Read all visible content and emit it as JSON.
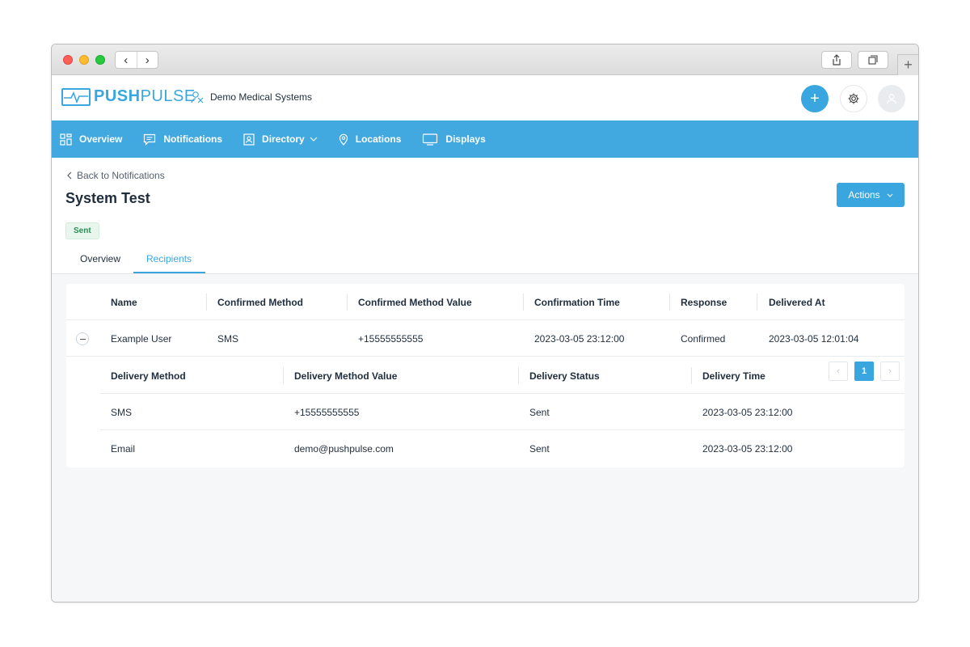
{
  "colors": {
    "accent": "#3aa6df",
    "nav_bg": "#42a8e0",
    "badge_text": "#2e8b57"
  },
  "browser": {
    "back_glyph": "‹",
    "forward_glyph": "›",
    "new_tab_glyph": "+"
  },
  "header": {
    "logo_bold": "PUSH",
    "logo_light": "PULSE",
    "org_name": "Demo Medical Systems",
    "plus_glyph": "+"
  },
  "nav": {
    "items": [
      {
        "label": "Overview",
        "icon": "grid-icon"
      },
      {
        "label": "Notifications",
        "icon": "message-icon"
      },
      {
        "label": "Directory",
        "icon": "contact-card-icon"
      },
      {
        "label": "Locations",
        "icon": "map-pin-icon"
      },
      {
        "label": "Displays",
        "icon": "monitor-icon"
      }
    ]
  },
  "page": {
    "back_label": "Back to Notifications",
    "title": "System Test",
    "status": "Sent",
    "actions_label": "Actions",
    "tabs": [
      {
        "label": "Overview",
        "active": false
      },
      {
        "label": "Recipients",
        "active": true
      }
    ]
  },
  "recipients": {
    "columns": [
      "Name",
      "Confirmed Method",
      "Confirmed Method Value",
      "Confirmation Time",
      "Response",
      "Delivered At"
    ],
    "rows": [
      {
        "name": "Example User",
        "confirmed_method": "SMS",
        "confirmed_method_value": "+15555555555",
        "confirmation_time": "2023-03-05 23:12:00",
        "response": "Confirmed",
        "delivered_at": "2023-03-05 12:01:04"
      }
    ],
    "deliveries": {
      "columns": [
        "Delivery Method",
        "Delivery Method Value",
        "Delivery Status",
        "Delivery Time"
      ],
      "rows": [
        {
          "method": "SMS",
          "value": "+15555555555",
          "status": "Sent",
          "time": "2023-03-05 23:12:00"
        },
        {
          "method": "Email",
          "value": "demo@pushpulse.com",
          "status": "Sent",
          "time": "2023-03-05 23:12:00"
        }
      ]
    }
  },
  "pagination": {
    "current": "1",
    "prev_glyph": "‹",
    "next_glyph": "›"
  }
}
